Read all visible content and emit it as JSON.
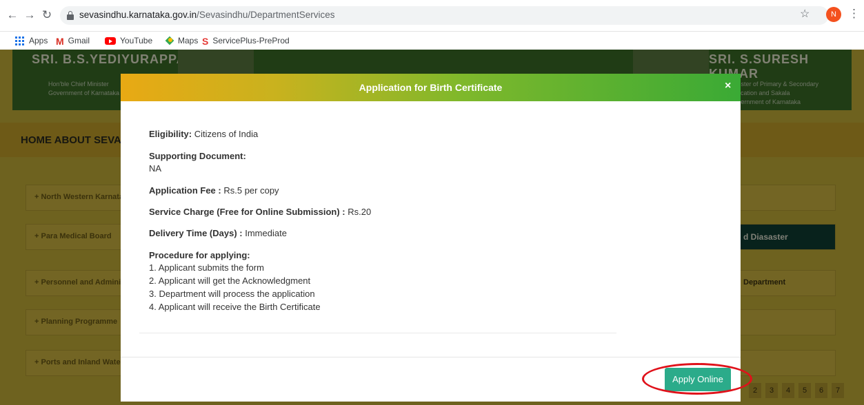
{
  "browser": {
    "url_domain": "sevasindhu.karnataka.gov.in",
    "url_path": "/Sevasindhu/DepartmentServices",
    "profile_initial": "N",
    "bookmarks": [
      "Apps",
      "Gmail",
      "YouTube",
      "Maps",
      "ServicePlus-PreProd"
    ]
  },
  "background": {
    "hero_left_name": "SRI. B.S.YEDIYURAPPA",
    "hero_left_sub": "Hon'ble Chief Minister\nGovernment of Karnataka",
    "hero_right_name": "SRI. S.SURESH KUMAR",
    "hero_right_sub": "Minister of Primary & Secondary\nEducation and Sakala\nGovernment of Karnataka",
    "menu": "HOME   ABOUT SEVA SINDHU",
    "rows_left": [
      "+ North Western Karnataka",
      "+ Para Medical Board",
      "+ Personnel and Administrative",
      "+ Planning Programme",
      "+ Ports and Inland Water Transport"
    ],
    "row_dark_label": "d Diasaster",
    "row_right_label": "Department",
    "pager": [
      "2",
      "3",
      "4",
      "5",
      "6",
      "7"
    ]
  },
  "modal": {
    "title": "Application for Birth Certificate",
    "close": "×",
    "eligibility_label": "Eligibility:",
    "eligibility_value": "Citizens of India",
    "supporting_label": "Supporting Document:",
    "supporting_value": "NA",
    "fee_label": "Application Fee :",
    "fee_value": "Rs.5 per copy",
    "service_label": "Service Charge (Free for Online Submission) :",
    "service_value": "Rs.20",
    "delivery_label": "Delivery Time (Days) :",
    "delivery_value": "Immediate",
    "procedure_label": "Procedure for applying:",
    "steps": [
      "1. Applicant submits the form",
      "2. Applicant will get the Acknowledgment",
      "3. Department will process the application",
      "4. Applicant will receive the Birth Certificate"
    ],
    "apply_button": "Apply Online"
  }
}
